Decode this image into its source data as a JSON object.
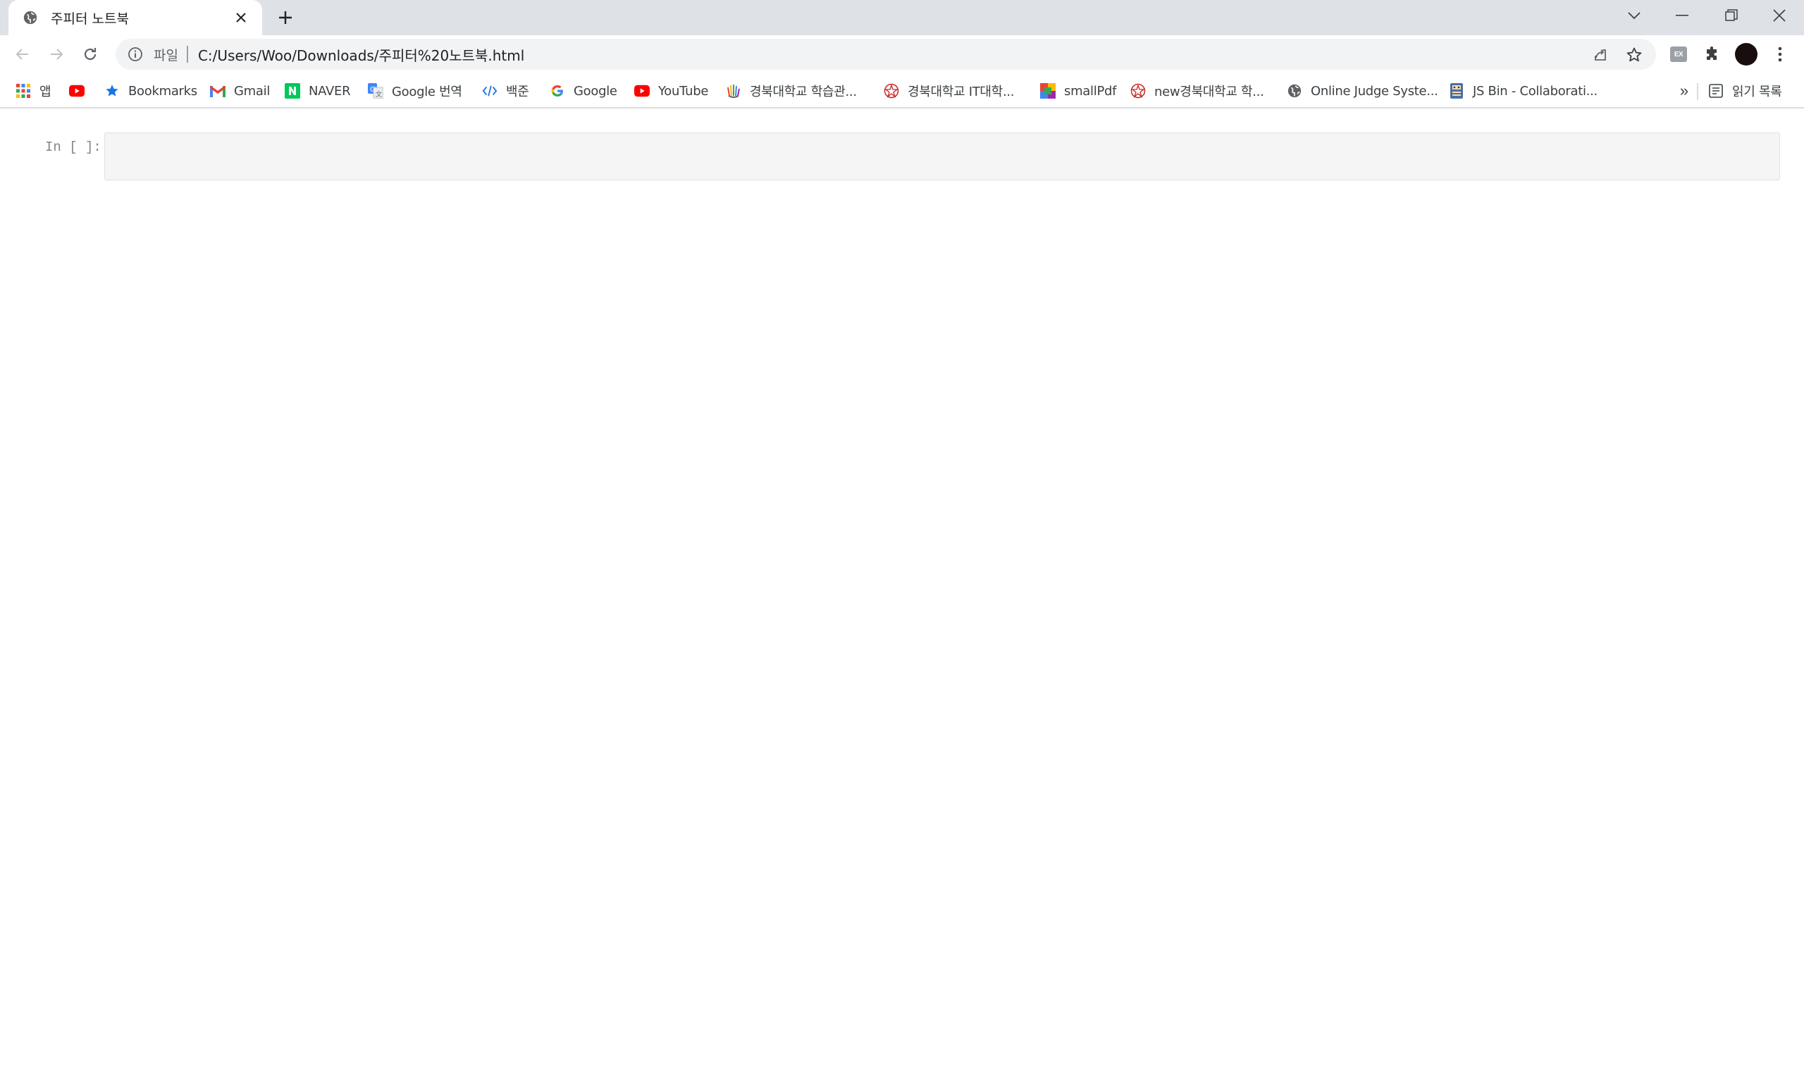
{
  "browser": {
    "tab": {
      "title": "주피터 노트북",
      "favicon": "globe-icon"
    },
    "new_tab_icon": "plus-icon",
    "window_controls": [
      "chevron-down-icon",
      "minimize-icon",
      "restore-icon",
      "close-icon"
    ],
    "address_bar": {
      "scheme_label": "파일",
      "url": "C:/Users/Woo/Downloads/주피터%20노트북.html"
    },
    "extension_badge": "EX"
  },
  "bookmarks": {
    "items": [
      {
        "label": "앱",
        "icon": "apps-grid-icon"
      },
      {
        "label": "",
        "icon": "youtube-icon"
      },
      {
        "label": "Bookmarks",
        "icon": "star-icon"
      },
      {
        "label": "Gmail",
        "icon": "gmail-icon"
      },
      {
        "label": "NAVER",
        "icon": "naver-icon"
      },
      {
        "label": "Google 번역",
        "icon": "translate-icon"
      },
      {
        "label": "백준",
        "icon": "code-icon"
      },
      {
        "label": "Google",
        "icon": "google-icon"
      },
      {
        "label": "YouTube",
        "icon": "youtube-icon"
      },
      {
        "label": "경북대학교 학습관...",
        "icon": "hand-logo-icon"
      },
      {
        "label": "경북대학교 IT대학...",
        "icon": "knu-emblem-icon"
      },
      {
        "label": "smallPdf",
        "icon": "smallpdf-icon"
      },
      {
        "label": "new경북대학교 학...",
        "icon": "knu-emblem-icon"
      },
      {
        "label": "Online Judge Syste...",
        "icon": "globe-icon"
      },
      {
        "label": "JS Bin - Collaborati...",
        "icon": "jsbin-icon"
      }
    ],
    "overflow": "»",
    "reading_list": "읽기 목록"
  },
  "notebook": {
    "cells": [
      {
        "prompt": "In [ ]:",
        "source": ""
      }
    ]
  },
  "colors": {
    "tab_strip": "#dee1e6",
    "omnibox": "#f1f3f4",
    "cell_background": "#f5f5f5",
    "prompt_text": "#858585"
  }
}
